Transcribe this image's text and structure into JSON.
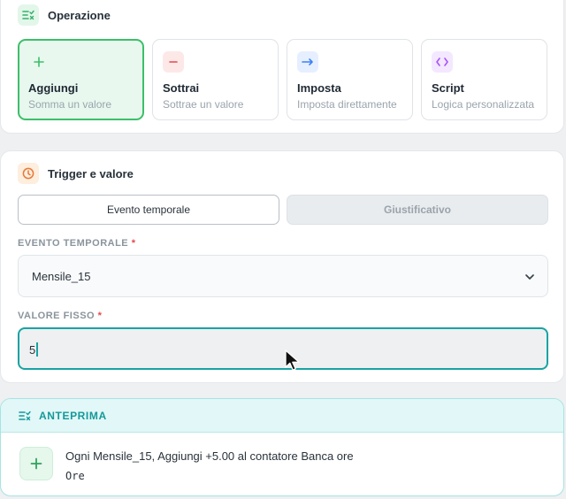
{
  "operation": {
    "title": "Operazione",
    "icon": "list-check-icon",
    "options": [
      {
        "label": "Aggiungi",
        "sub": "Somma un valore",
        "icon": "plus-icon",
        "color": "#3cbf6a",
        "selected": true
      },
      {
        "label": "Sottrai",
        "sub": "Sottrae un valore",
        "icon": "minus-icon",
        "color": "#e5484d",
        "selected": false
      },
      {
        "label": "Imposta",
        "sub": "Imposta direttamente",
        "icon": "arrow-right-icon",
        "color": "#3b82f6",
        "selected": false
      },
      {
        "label": "Script",
        "sub": "Logica personalizzata",
        "icon": "code-icon",
        "color": "#a855f7",
        "selected": false
      }
    ]
  },
  "trigger": {
    "title": "Trigger e valore",
    "icon": "clock-icon",
    "tabs": [
      "Evento temporale",
      "Giustificativo"
    ],
    "active_tab": "Evento temporale",
    "event_label": "EVENTO TEMPORALE",
    "required_mark": "*",
    "event_value": "Mensile_15",
    "value_label": "VALORE FISSO",
    "value": "5"
  },
  "preview": {
    "title": "ANTEPRIMA",
    "icon": "list-check-icon",
    "text": "Ogni Mensile_15, Aggiungi +5.00 al contatore Banca ore",
    "unit": "Ore",
    "accent": "#14999a"
  }
}
